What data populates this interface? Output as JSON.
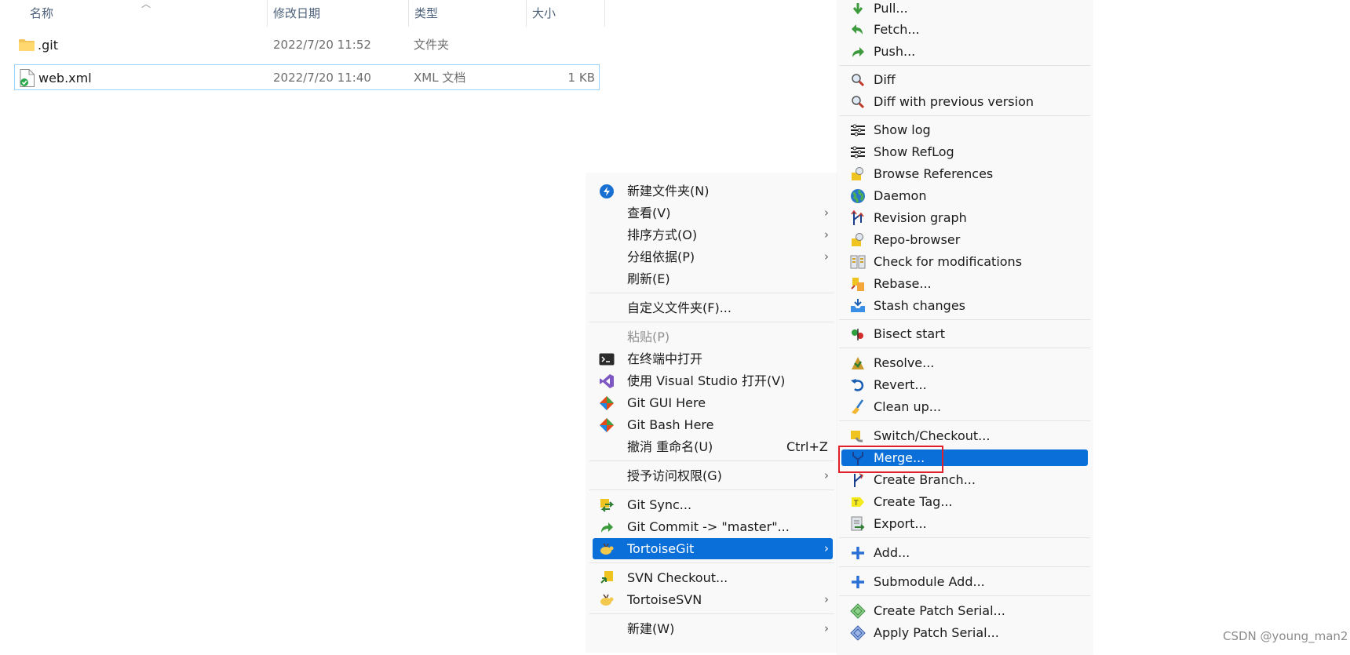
{
  "file_list": {
    "headers": {
      "name": "名称",
      "modified": "修改日期",
      "type": "类型",
      "size": "大小"
    },
    "rows": [
      {
        "name": ".git",
        "modified": "2022/7/20 11:52",
        "type": "文件夹",
        "size": ""
      },
      {
        "name": "web.xml",
        "modified": "2022/7/20 11:40",
        "type": "XML 文档",
        "size": "1 KB"
      }
    ]
  },
  "context_menu": {
    "items": [
      {
        "label": "新建文件夹(N)",
        "icon": "new-folder-icon"
      },
      {
        "label": "查看(V)",
        "chevron": "›"
      },
      {
        "label": "排序方式(O)",
        "chevron": "›"
      },
      {
        "label": "分组依据(P)",
        "chevron": "›"
      },
      {
        "label": "刷新(E)"
      },
      {
        "label": "自定义文件夹(F)..."
      },
      {
        "label": "粘贴(P)",
        "disabled": true
      },
      {
        "label": "在终端中打开",
        "icon": "terminal-icon"
      },
      {
        "label": "使用 Visual Studio 打开(V)",
        "icon": "visual-studio-icon"
      },
      {
        "label": "Git GUI Here",
        "icon": "git-gui-icon"
      },
      {
        "label": "Git Bash Here",
        "icon": "git-bash-icon"
      },
      {
        "label": "撤消 重命名(U)",
        "shortcut": "Ctrl+Z"
      },
      {
        "label": "授予访问权限(G)",
        "chevron": "›"
      },
      {
        "label": "Git Sync...",
        "icon": "git-sync-icon"
      },
      {
        "label": "Git Commit -> \"master\"...",
        "icon": "git-commit-icon"
      },
      {
        "label": "TortoiseGit",
        "icon": "tortoisegit-icon",
        "chevron": "›",
        "highlighted": true
      },
      {
        "label": "SVN Checkout...",
        "icon": "svn-checkout-icon"
      },
      {
        "label": "TortoiseSVN",
        "icon": "tortoisesvn-icon",
        "chevron": "›"
      },
      {
        "label": "新建(W)",
        "chevron": "›"
      }
    ]
  },
  "submenu": {
    "items": [
      {
        "label": "Pull...",
        "icon": "pull-icon"
      },
      {
        "label": "Fetch...",
        "icon": "fetch-icon"
      },
      {
        "label": "Push...",
        "icon": "push-icon"
      },
      {
        "label": "Diff",
        "icon": "diff-icon"
      },
      {
        "label": "Diff with previous version",
        "icon": "diff-previous-icon"
      },
      {
        "label": "Show log",
        "icon": "show-log-icon"
      },
      {
        "label": "Show RefLog",
        "icon": "show-reflog-icon"
      },
      {
        "label": "Browse References",
        "icon": "browse-references-icon"
      },
      {
        "label": "Daemon",
        "icon": "daemon-icon"
      },
      {
        "label": "Revision graph",
        "icon": "revision-graph-icon"
      },
      {
        "label": "Repo-browser",
        "icon": "repo-browser-icon"
      },
      {
        "label": "Check for modifications",
        "icon": "check-modifications-icon"
      },
      {
        "label": "Rebase...",
        "icon": "rebase-icon"
      },
      {
        "label": "Stash changes",
        "icon": "stash-icon"
      },
      {
        "label": "Bisect start",
        "icon": "bisect-icon"
      },
      {
        "label": "Resolve...",
        "icon": "resolve-icon"
      },
      {
        "label": "Revert...",
        "icon": "revert-icon"
      },
      {
        "label": "Clean up...",
        "icon": "cleanup-icon"
      },
      {
        "label": "Switch/Checkout...",
        "icon": "switch-checkout-icon"
      },
      {
        "label": "Merge...",
        "icon": "merge-icon",
        "highlighted": true
      },
      {
        "label": "Create Branch...",
        "icon": "create-branch-icon"
      },
      {
        "label": "Create Tag...",
        "icon": "create-tag-icon"
      },
      {
        "label": "Export...",
        "icon": "export-icon"
      },
      {
        "label": "Add...",
        "icon": "add-icon"
      },
      {
        "label": "Submodule Add...",
        "icon": "submodule-add-icon"
      },
      {
        "label": "Create Patch Serial...",
        "icon": "create-patch-icon"
      },
      {
        "label": "Apply Patch Serial...",
        "icon": "apply-patch-icon"
      }
    ]
  },
  "watermark": "CSDN @young_man2",
  "colors": {
    "highlight": "#0a6fd8",
    "annotation_box": "#e0202a",
    "selection_border": "#99d1ff"
  }
}
